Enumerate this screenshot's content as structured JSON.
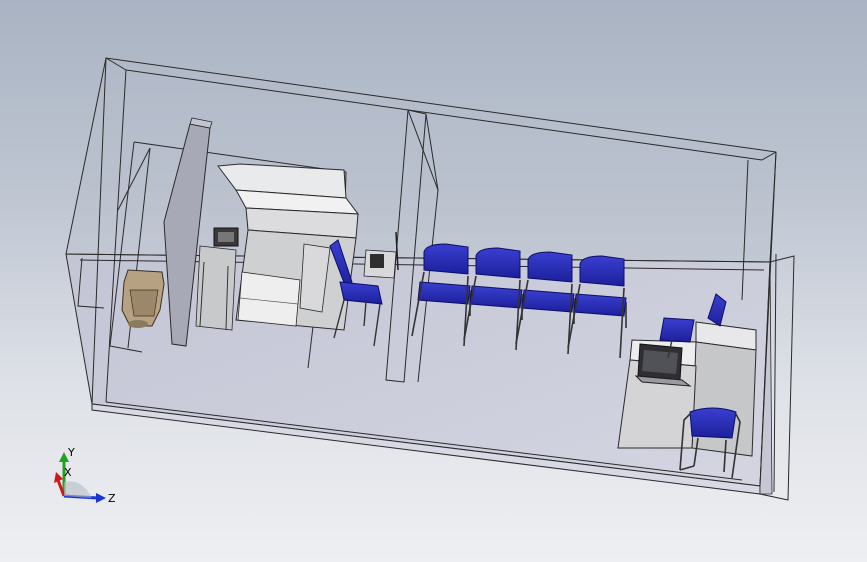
{
  "viewport": {
    "background_top": "#a9b3c3",
    "background_bottom": "#eeeff2"
  },
  "model": {
    "shell_color": "#c9cad8",
    "seat_color": "#2b2fb8",
    "seat_dark": "#15188a",
    "furniture_light": "#ededed",
    "furniture_mid": "#bfc0c2",
    "partition_color": "#a4a6b4",
    "toilet_color": "#b8a486",
    "waiting_chair_count": 4
  },
  "triad": {
    "x_label": "X",
    "y_label": "Y",
    "z_label": "Z",
    "x_color": "#d01818",
    "y_color": "#22a022",
    "z_color": "#1a36d8"
  }
}
